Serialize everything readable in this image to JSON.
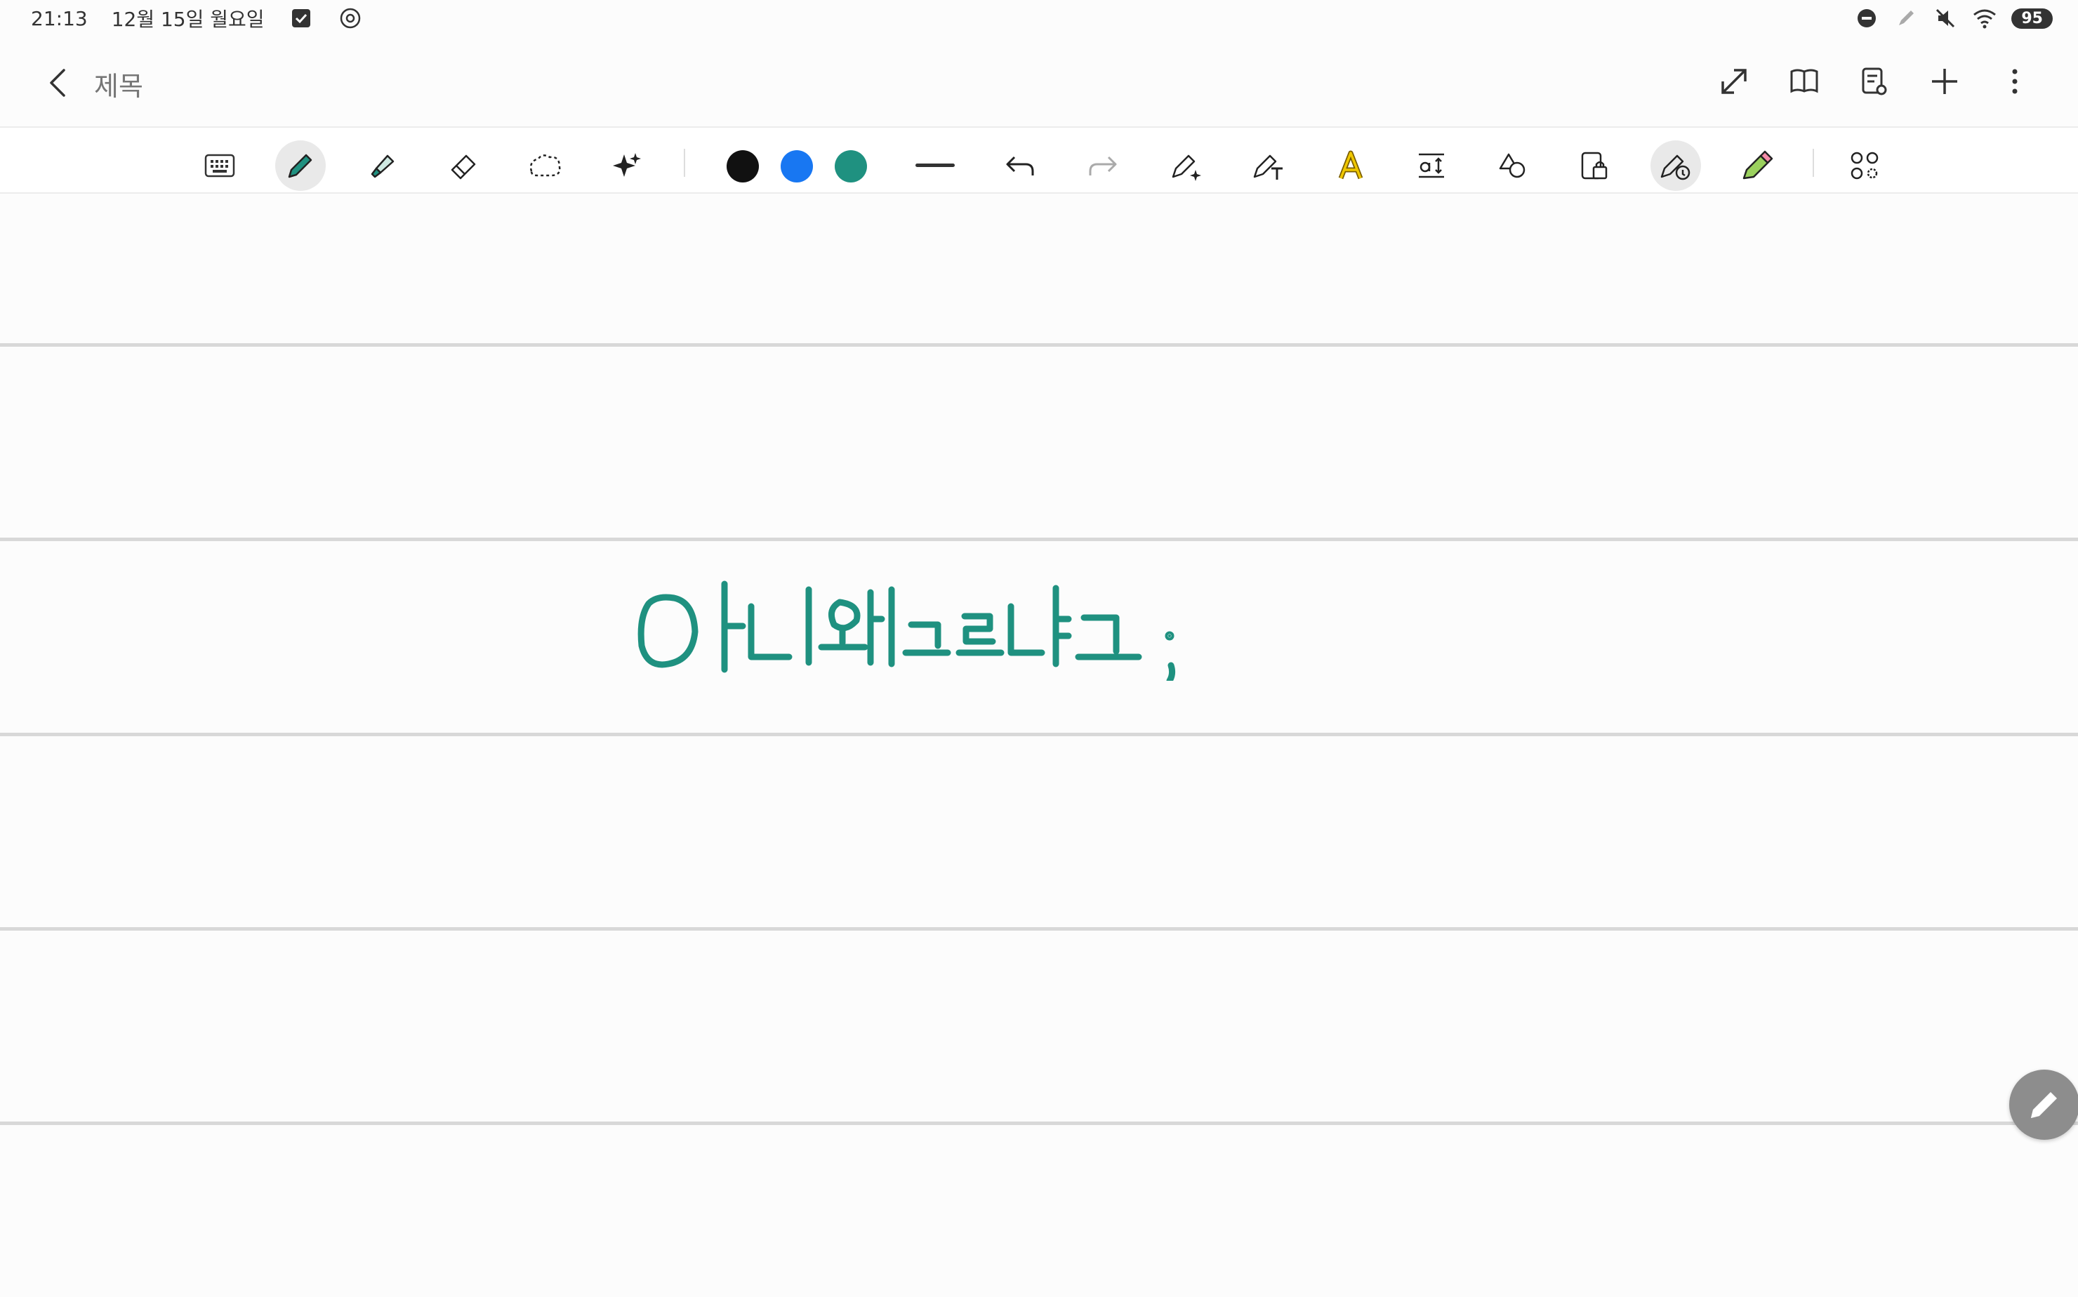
{
  "status_bar": {
    "time": "21:13",
    "date": "12월 15일 월요일",
    "battery": "95"
  },
  "header": {
    "title": "제목"
  },
  "toolbar": {
    "colors": [
      "#111111",
      "#1877f2",
      "#1f9180"
    ]
  },
  "note": {
    "handwriting_text": "아니왜그르냐고 ;"
  },
  "icons": {
    "back": "back-chevron-icon",
    "fab": "pen-icon"
  }
}
